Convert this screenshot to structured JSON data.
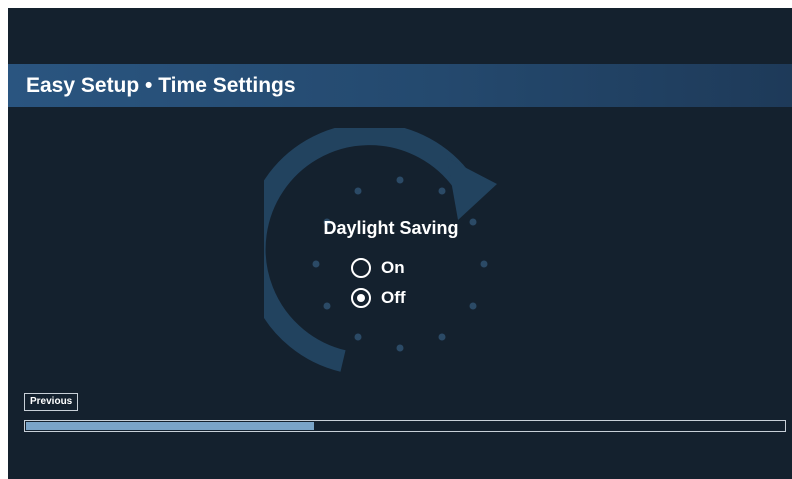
{
  "header": {
    "title": "Easy Setup • Time Settings"
  },
  "setting": {
    "title": "Daylight Saving",
    "options": [
      {
        "label": "On",
        "selected": false
      },
      {
        "label": "Off",
        "selected": true
      }
    ]
  },
  "navigation": {
    "previous_label": "Previous"
  },
  "progress": {
    "fraction": 0.38
  },
  "background_graphic": {
    "icon": "clock-refresh-icon"
  },
  "colors": {
    "background": "#14212e",
    "header_bar": "#2a5580",
    "progress_fill": "#7aa4c8",
    "text": "#ffffff"
  }
}
